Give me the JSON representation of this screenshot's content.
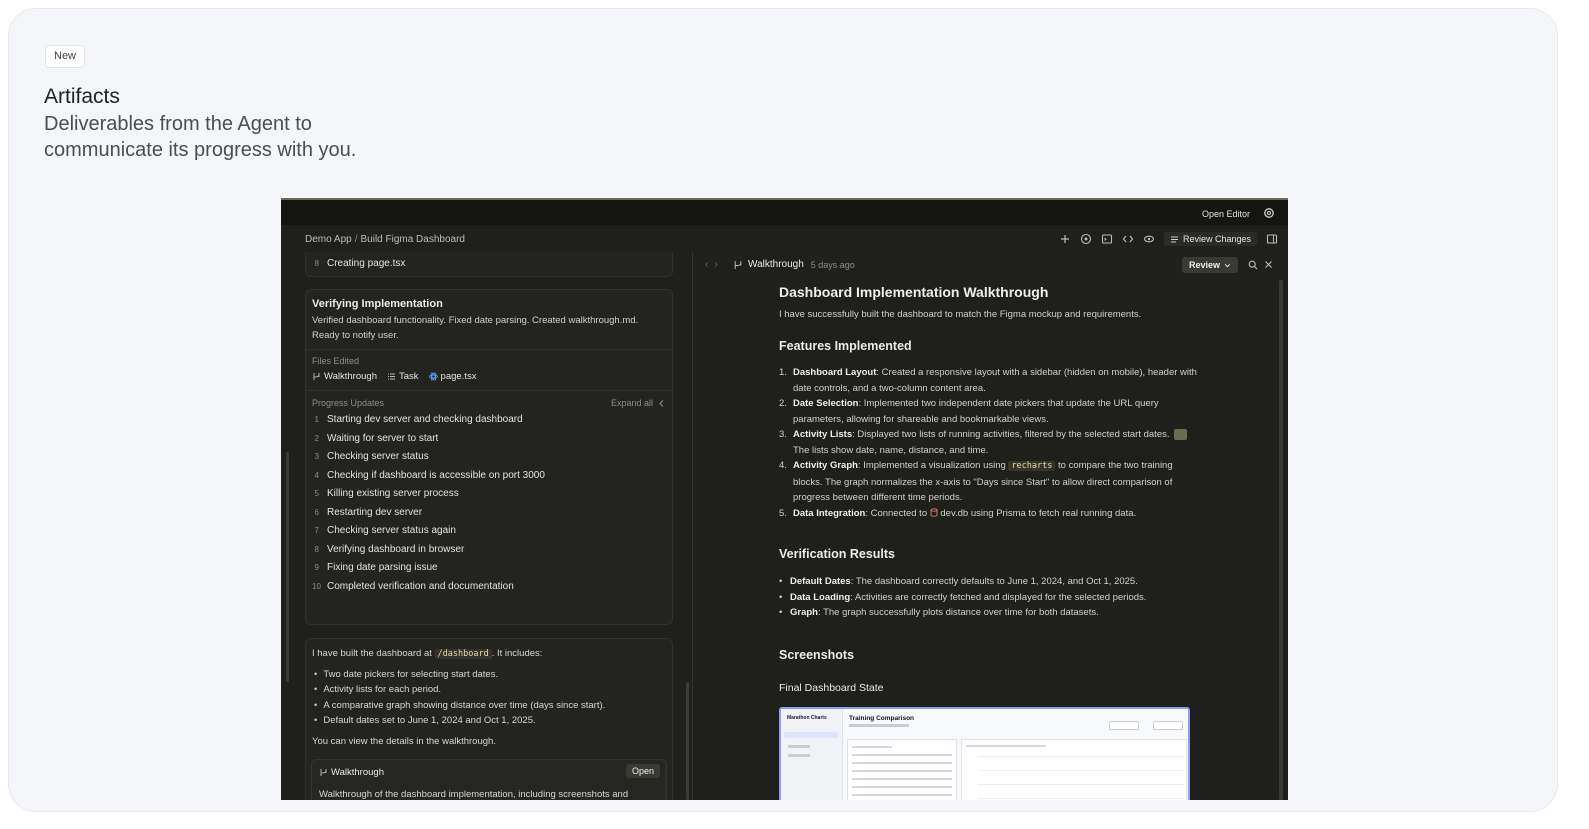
{
  "badge": "New",
  "hero": {
    "title": "Artifacts",
    "subtitle": "Deliverables from the Agent to communicate its progress with you."
  },
  "app": {
    "open_editor": "Open Editor",
    "breadcrumb": {
      "project": "Demo App",
      "separator": "/",
      "task": "Build Figma Dashboard"
    },
    "review_changes": "Review Changes",
    "left": {
      "prev_step": {
        "num": "8",
        "label": "Creating page.tsx"
      },
      "verify": {
        "title": "Verifying Implementation",
        "desc": "Verified dashboard functionality. Fixed date parsing. Created walkthrough.md. Ready to notify user."
      },
      "files_label": "Files Edited",
      "files": [
        {
          "name": "Walkthrough",
          "icon": "walkthrough-icon"
        },
        {
          "name": "Task",
          "icon": "task-icon"
        },
        {
          "name": "page.tsx",
          "icon": "react-icon"
        }
      ],
      "progress_label": "Progress Updates",
      "expand_all": "Expand all",
      "steps": [
        {
          "num": "1",
          "label": "Starting dev server and checking dashboard"
        },
        {
          "num": "2",
          "label": "Waiting for server to start"
        },
        {
          "num": "3",
          "label": "Checking server status"
        },
        {
          "num": "4",
          "label": "Checking if dashboard is accessible on port 3000"
        },
        {
          "num": "5",
          "label": "Killing existing server process"
        },
        {
          "num": "6",
          "label": "Restarting dev server"
        },
        {
          "num": "7",
          "label": "Checking server status again"
        },
        {
          "num": "8",
          "label": "Verifying dashboard in browser"
        },
        {
          "num": "9",
          "label": "Fixing date parsing issue"
        },
        {
          "num": "10",
          "label": "Completed verification and documentation"
        }
      ],
      "message": {
        "intro_before": "I have built the dashboard at ",
        "intro_code": "/dashboard",
        "intro_after": ". It includes:",
        "bullets": [
          "Two date pickers for selecting start dates.",
          "Activity lists for each period.",
          "A comparative graph showing distance over time (days since start).",
          "Default dates set to June 1, 2024 and Oct 1, 2025."
        ],
        "outro": "You can view the details in the walkthrough."
      },
      "walkthrough_card": {
        "title": "Walkthrough",
        "open": "Open",
        "desc": "Walkthrough of the dashboard implementation, including screenshots and"
      }
    },
    "right": {
      "tab": "Walkthrough",
      "ago": "5 days ago",
      "review": "Review",
      "doc": {
        "title": "Dashboard Implementation Walkthrough",
        "intro": "I have successfully built the dashboard to match the Figma mockup and requirements.",
        "features_title": "Features Implemented",
        "features": [
          {
            "n": "1.",
            "b": "Dashboard Layout",
            "t": ": Created a responsive layout with a sidebar (hidden on mobile), header with date controls, and a two-column content area."
          },
          {
            "n": "2.",
            "b": "Date Selection",
            "t": ": Implemented two independent date pickers that update the URL query parameters, allowing for shareable and bookmarkable views."
          },
          {
            "n": "3.",
            "b": "Activity Lists",
            "t": ": Displayed two lists of running activities, filtered by the selected start dates.",
            "t2": "The lists show date, name, distance, and time."
          },
          {
            "n": "4.",
            "b": "Activity Graph",
            "t": ": Implemented a visualization using ",
            "code": "recharts",
            "t2": " to compare the two training blocks. The graph normalizes the x-axis to \"Days since Start\" to allow direct comparison of progress between different time periods."
          },
          {
            "n": "5.",
            "b": "Data Integration",
            "t": ": Connected to ",
            "db": "dev.db",
            "t2": " using Prisma to fetch real running data."
          }
        ],
        "verify_title": "Verification Results",
        "results": [
          {
            "b": "Default Dates",
            "t": ": The dashboard correctly defaults to June 1, 2024, and Oct 1, 2025."
          },
          {
            "b": "Data Loading",
            "t": ": Activities are correctly fetched and displayed for the selected periods."
          },
          {
            "b": "Graph",
            "t": ": The graph successfully plots distance over time for both datasets."
          }
        ],
        "screens_title": "Screenshots",
        "final_state": "Final Dashboard State",
        "preview": {
          "brand": "Marathon Charts",
          "title": "Training Comparison"
        }
      }
    }
  }
}
